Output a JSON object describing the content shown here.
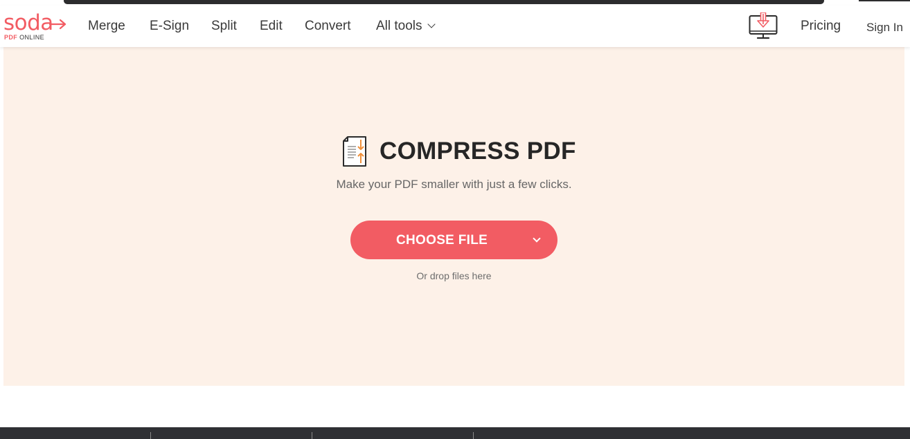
{
  "brand": {
    "name": "soda",
    "sub_pdf": "PDF",
    "sub_online": "ONLINE",
    "accent": "#f25c63"
  },
  "nav": {
    "items": [
      {
        "label": "Merge"
      },
      {
        "label": "E-Sign"
      },
      {
        "label": "Split"
      },
      {
        "label": "Edit"
      },
      {
        "label": "Convert"
      },
      {
        "label": "All tools"
      }
    ],
    "pricing": "Pricing",
    "signin": "Sign In",
    "desktop_icon": "desktop-download-icon"
  },
  "hero": {
    "background": "#fdf1e8",
    "icon": "compress-pdf-icon",
    "title": "COMPRESS PDF",
    "subtitle": "Make your PDF smaller with just a few clicks.",
    "button_label": "CHOOSE FILE",
    "drop_hint": "Or drop files here"
  },
  "footer": {
    "background": "#2f3034"
  }
}
